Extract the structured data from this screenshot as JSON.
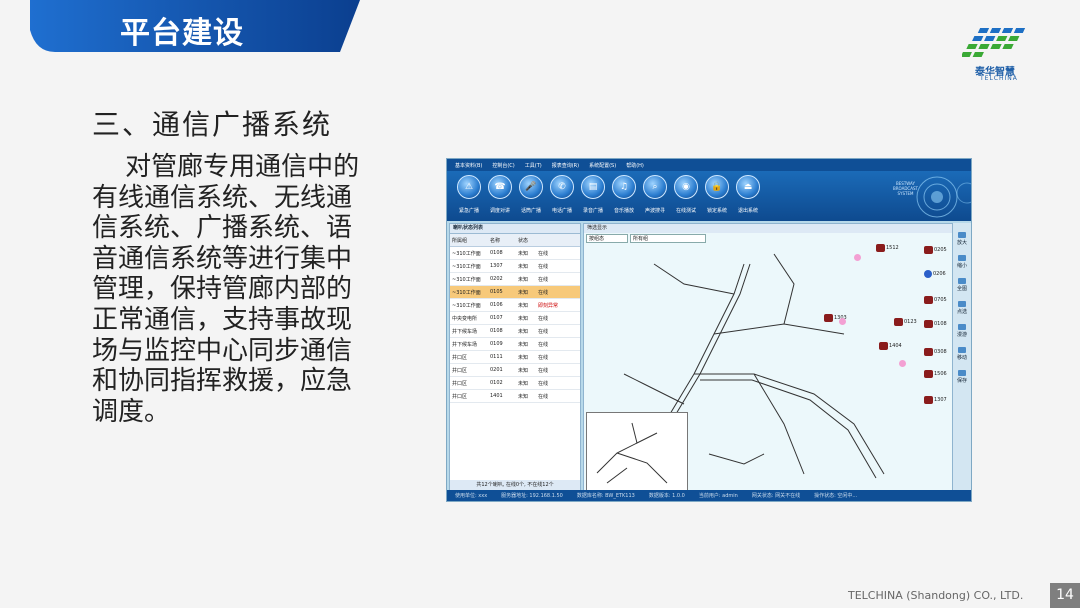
{
  "header": {
    "title": "平台建设"
  },
  "logo": {
    "name": "泰华智慧",
    "sub": "TELCHINA"
  },
  "section_title": "三、通信广播系统",
  "body_text": "对管廊专用通信中的有线通信系统、无线通信系统、广播系统、语音通信系统等进行集中管理，保持管廊内部的正常通信，支持事故现场与监控中心同步通信和协同指挥救援，应急调度。",
  "footer": {
    "company": "TELCHINA (Shandong) CO., LTD.",
    "page": "14"
  },
  "app": {
    "menu": [
      "基本资料",
      "控制台",
      "工具",
      "报表查询",
      "系统配置",
      "帮助"
    ],
    "tools": [
      {
        "label": "紧急广播",
        "icon": "warning-icon",
        "glyph": "⚠"
      },
      {
        "label": "调度对讲",
        "icon": "intercom-icon",
        "glyph": "☎"
      },
      {
        "label": "话筒广播",
        "icon": "microphone-icon",
        "glyph": "🎤"
      },
      {
        "label": "电话广播",
        "icon": "phone-icon",
        "glyph": "✆"
      },
      {
        "label": "录音广播",
        "icon": "record-icon",
        "glyph": "▤"
      },
      {
        "label": "音乐播放",
        "icon": "music-icon",
        "glyph": "♫"
      },
      {
        "label": "声波搜寻",
        "icon": "search-icon",
        "glyph": "⌕"
      },
      {
        "label": "在线测试",
        "icon": "test-icon",
        "glyph": "◉"
      },
      {
        "label": "锁定系统",
        "icon": "lock-icon",
        "glyph": "🔒"
      },
      {
        "label": "退出系统",
        "icon": "exit-icon",
        "glyph": "⏏"
      }
    ],
    "brand_lines": [
      "BESTWAY",
      "BROADCAST",
      "SYSTEM"
    ],
    "panel_title": "喇叭状态列表",
    "columns": [
      "所属组",
      "名称",
      "状态"
    ],
    "rows": [
      {
        "group": "~310工作面",
        "name": "0108",
        "s1": "未知",
        "s2": "在线"
      },
      {
        "group": "~310工作面",
        "name": "1307",
        "s1": "未知",
        "s2": "在线"
      },
      {
        "group": "~310工作面",
        "name": "0202",
        "s1": "未知",
        "s2": "在线"
      },
      {
        "group": "~310工作面",
        "name": "0105",
        "s1": "未知",
        "s2": "在线",
        "selected": true
      },
      {
        "group": "~310工作面",
        "name": "0106",
        "s1": "未知",
        "s2": "即刻异常"
      },
      {
        "group": "中央变电所",
        "name": "0107",
        "s1": "未知",
        "s2": "在线"
      },
      {
        "group": "井下候车场",
        "name": "0108",
        "s1": "未知",
        "s2": "在线"
      },
      {
        "group": "井下候车场",
        "name": "0109",
        "s1": "未知",
        "s2": "在线"
      },
      {
        "group": "井口区",
        "name": "0111",
        "s1": "未知",
        "s2": "在线"
      },
      {
        "group": "井口区",
        "name": "0201",
        "s1": "未知",
        "s2": "在线"
      },
      {
        "group": "井口区",
        "name": "0102",
        "s1": "未知",
        "s2": "在线"
      },
      {
        "group": "井口区",
        "name": "1401",
        "s1": "未知",
        "s2": "在线"
      }
    ],
    "panel_status": "共12个喇叭, 在线0个, 不在线12个",
    "map_title": "筛选显示",
    "map_filter1": "按组态",
    "map_filter2": "所有组",
    "devices": [
      "1512",
      "0205",
      "0206",
      "0705",
      "1303",
      "0123",
      "0108",
      "1404",
      "0308",
      "1506",
      "1307"
    ],
    "sidebar": [
      "放大",
      "缩小",
      "全图",
      "点选",
      "漫游",
      "移动",
      "保存"
    ],
    "statusbar": [
      "使用单位: xxx",
      "服务器地址: 192.168.1.50",
      "数据库名称: BW_ETK113",
      "数据版本: 1.0.0",
      "当前用户: admin",
      "网关状态: 网关不在线",
      "操作状态: 空闲中..."
    ]
  }
}
